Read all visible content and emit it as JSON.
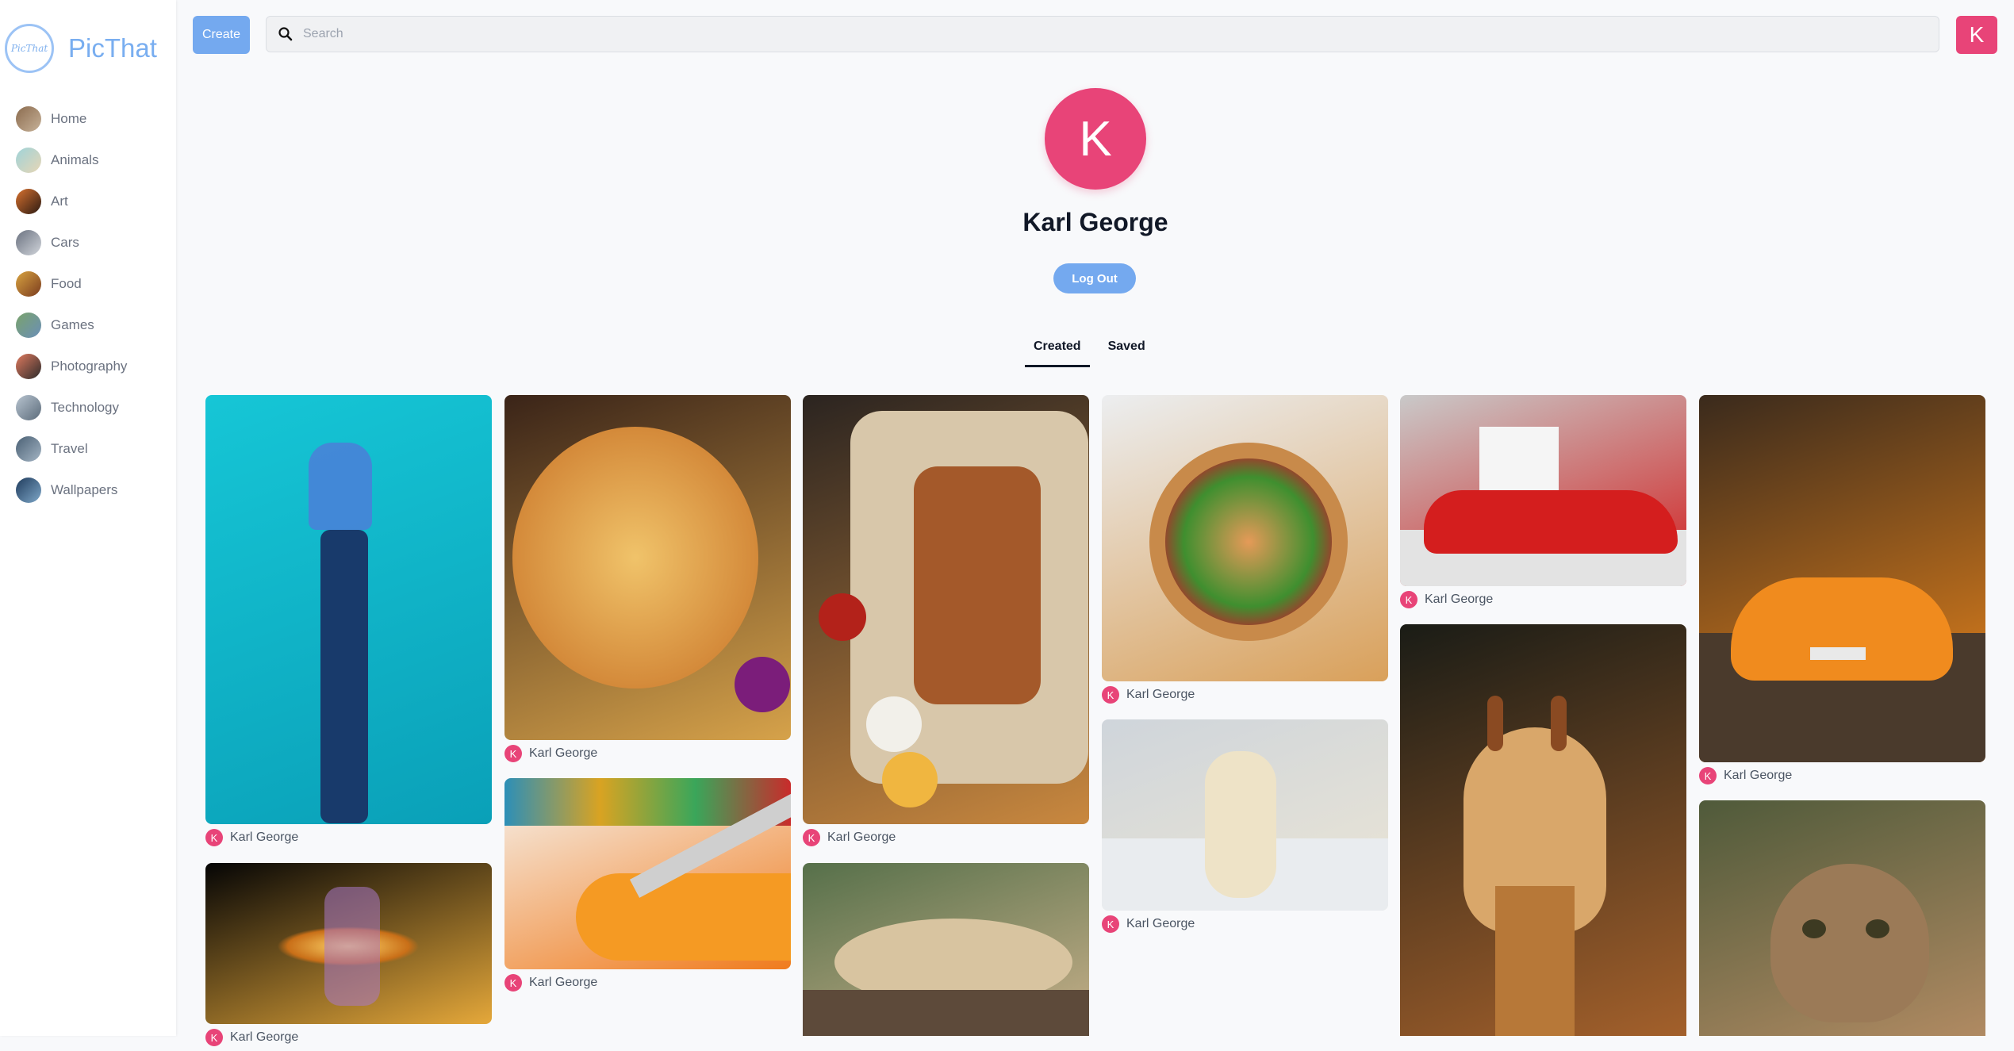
{
  "app": {
    "logo_text": "PicThat",
    "logo_mark": "PicThat"
  },
  "sidebar": {
    "categories": [
      {
        "label": "Home",
        "icon": "home-thumb",
        "colors": [
          "#8b6b4e",
          "#c7b299"
        ]
      },
      {
        "label": "Animals",
        "icon": "animals-thumb",
        "colors": [
          "#9fd3d9",
          "#e7d6b5"
        ]
      },
      {
        "label": "Art",
        "icon": "art-thumb",
        "colors": [
          "#d8712f",
          "#2b1a12"
        ]
      },
      {
        "label": "Cars",
        "icon": "cars-thumb",
        "colors": [
          "#6b7280",
          "#d1d5db"
        ]
      },
      {
        "label": "Food",
        "icon": "food-thumb",
        "colors": [
          "#d9a441",
          "#7a3b1e"
        ]
      },
      {
        "label": "Games",
        "icon": "games-thumb",
        "colors": [
          "#7aa36b",
          "#6b8fb8"
        ]
      },
      {
        "label": "Photography",
        "icon": "photography-thumb",
        "colors": [
          "#e07a5f",
          "#2b2a2a"
        ]
      },
      {
        "label": "Technology",
        "icon": "technology-thumb",
        "colors": [
          "#b8c4d0",
          "#5b6b7a"
        ]
      },
      {
        "label": "Travel",
        "icon": "travel-thumb",
        "colors": [
          "#4a6074",
          "#a4b5c4"
        ]
      },
      {
        "label": "Wallpapers",
        "icon": "wallpapers-thumb",
        "colors": [
          "#1f3b5c",
          "#7fa8c9"
        ]
      }
    ]
  },
  "topbar": {
    "create_label": "Create",
    "search_placeholder": "Search",
    "avatar_initial": "K"
  },
  "profile": {
    "initial": "K",
    "name": "Karl George",
    "logout_label": "Log Out"
  },
  "tabs": [
    {
      "label": "Created",
      "active": true
    },
    {
      "label": "Saved",
      "active": false
    }
  ],
  "pins": [
    {
      "name": "robotic-hand",
      "author_initial": "K",
      "author": "Karl George",
      "colors": [
        "#16c6d6",
        "#0aa0b8"
      ]
    },
    {
      "name": "pizza",
      "author_initial": "K",
      "author": "Karl George",
      "colors": [
        "#3a2418",
        "#d6a24a"
      ]
    },
    {
      "name": "grilled-platter",
      "author_initial": "K",
      "author": "Karl George",
      "colors": [
        "#2b2420",
        "#c9883f"
      ]
    },
    {
      "name": "salad-bowl",
      "author_initial": "K",
      "author": "Karl George",
      "colors": [
        "#eceef0",
        "#d9a05a"
      ]
    },
    {
      "name": "red-ferrari",
      "author_initial": "K",
      "author": "Karl George",
      "colors": [
        "#c9c9c9",
        "#d21f1f"
      ]
    },
    {
      "name": "orange-lamborghini",
      "author_initial": "K",
      "author": "Karl George",
      "colors": [
        "#3a2a1c",
        "#f28a1c"
      ]
    },
    {
      "name": "glowing-hand",
      "author_initial": "K",
      "author": "Karl George",
      "colors": [
        "#050505",
        "#e5a83a"
      ]
    },
    {
      "name": "paintbrush",
      "author_initial": "K",
      "author": "Karl George",
      "colors": [
        "#f6f3ee",
        "#f07b1d"
      ]
    },
    {
      "name": "leopard",
      "author_initial": "K",
      "author": "",
      "colors": [
        "#56704a",
        "#c8b08a"
      ]
    },
    {
      "name": "polar-bear",
      "author_initial": "K",
      "author": "Karl George",
      "colors": [
        "#cfd5db",
        "#ebe5d5"
      ]
    },
    {
      "name": "giraffe",
      "author_initial": "K",
      "author": "",
      "colors": [
        "#1a1c16",
        "#a3602b"
      ]
    },
    {
      "name": "kitten",
      "author_initial": "K",
      "author": "",
      "colors": [
        "#4f5a3a",
        "#b08a62"
      ]
    }
  ]
}
